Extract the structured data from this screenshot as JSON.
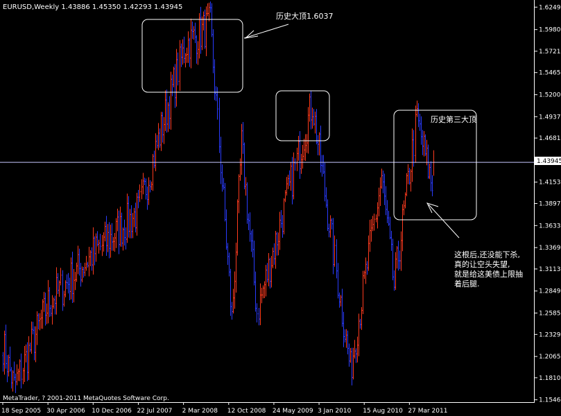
{
  "window": {
    "symbol_line": "EURUSD,Weekly  1.43886 1.45350 1.42293 1.43945",
    "copyright": "MetaTrader, ? 2001-2011 MetaQuotes Software Corp.",
    "current_price_label": "1.43945"
  },
  "annotations": {
    "peak1": "历史大顶1.6037",
    "peak3": "历史第三大顶",
    "comment_lines": [
      "这根后,还没能下杀,",
      "真的让空头失望,",
      "就是给这美债上限抽",
      "着后腿."
    ]
  },
  "colors": {
    "background": "#000000",
    "up_bar": "#ff3b1f",
    "down_bar": "#2a3cff",
    "grid_line": "#c8c8ff",
    "text": "#ffffff",
    "axis": "#ffffff"
  },
  "chart_data": {
    "type": "bar",
    "style": "ohlc",
    "title": "EURUSD,Weekly",
    "last_bar": {
      "open": 1.43886,
      "high": 1.4535,
      "low": 1.42293,
      "close": 1.43945
    },
    "ylim": [
      1.1518,
      1.6268
    ],
    "yticks": [
      "1.62490",
      "1.59800",
      "1.57210",
      "1.54650",
      "1.52000",
      "1.49370",
      "1.46810",
      "1.43945",
      "1.41530",
      "1.38970",
      "1.36330",
      "1.33690",
      "1.31130",
      "1.28490",
      "1.25850",
      "1.23290",
      "1.20650",
      "1.18100",
      "1.15460"
    ],
    "xticks": [
      "18 Sep 2005",
      "30 Apr 2006",
      "10 Dec 2006",
      "22 Jul 2007",
      "2 Mar 2008",
      "12 Oct 2008",
      "24 May 2009",
      "3 Jan 2010",
      "15 Aug 2010",
      "27 Mar 2011"
    ],
    "horizontal_line": 1.43945,
    "key_prices": [
      {
        "date": "2005-09-18",
        "price": 1.22
      },
      {
        "date": "2005-11-13",
        "price": 1.17
      },
      {
        "date": "2006-04-30",
        "price": 1.27
      },
      {
        "date": "2006-12-10",
        "price": 1.33
      },
      {
        "date": "2007-07-22",
        "price": 1.38
      },
      {
        "date": "2007-11-25",
        "price": 1.49
      },
      {
        "date": "2008-03-09",
        "price": 1.58
      },
      {
        "date": "2008-07-13",
        "price": 1.6037
      },
      {
        "date": "2008-10-26",
        "price": 1.25
      },
      {
        "date": "2008-12-14",
        "price": 1.46
      },
      {
        "date": "2009-03-01",
        "price": 1.26
      },
      {
        "date": "2009-11-29",
        "price": 1.51
      },
      {
        "date": "2010-06-06",
        "price": 1.19
      },
      {
        "date": "2010-11-07",
        "price": 1.42
      },
      {
        "date": "2011-01-09",
        "price": 1.29
      },
      {
        "date": "2011-05-01",
        "price": 1.49
      },
      {
        "date": "2011-07-17",
        "price": 1.41
      },
      {
        "date": "2011-07-24",
        "price": 1.43945
      }
    ]
  }
}
